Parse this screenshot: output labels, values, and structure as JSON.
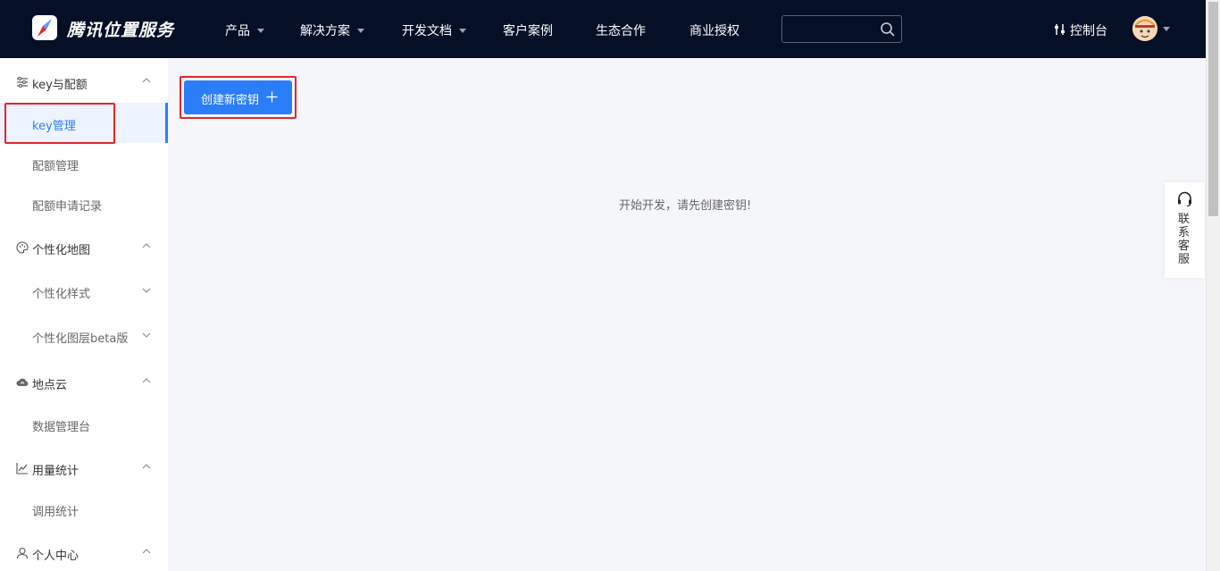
{
  "header": {
    "brand": "腾讯位置服务",
    "nav": [
      {
        "label": "产品",
        "has_dropdown": true
      },
      {
        "label": "解决方案",
        "has_dropdown": true
      },
      {
        "label": "开发文档",
        "has_dropdown": true
      },
      {
        "label": "客户案例",
        "has_dropdown": false
      },
      {
        "label": "生态合作",
        "has_dropdown": false
      },
      {
        "label": "商业授权",
        "has_dropdown": false
      }
    ],
    "search": {
      "value": "",
      "placeholder": ""
    },
    "console_label": "控制台"
  },
  "sidebar": {
    "groups": [
      {
        "label": "key与配额",
        "icon": "list-settings-icon",
        "expanded": true,
        "items": [
          {
            "label": "key管理",
            "active": true
          },
          {
            "label": "配额管理"
          },
          {
            "label": "配额申请记录"
          }
        ]
      },
      {
        "label": "个性化地图",
        "icon": "palette-icon",
        "expanded": true,
        "items": [
          {
            "label": "个性化样式",
            "expandable": true
          },
          {
            "label": "个性化图层beta版",
            "expandable": true
          }
        ]
      },
      {
        "label": "地点云",
        "icon": "cloud-icon",
        "expanded": true,
        "items": [
          {
            "label": "数据管理台"
          }
        ]
      },
      {
        "label": "用量统计",
        "icon": "line-chart-icon",
        "expanded": true,
        "items": [
          {
            "label": "调用统计"
          }
        ]
      },
      {
        "label": "个人中心",
        "icon": "user-icon",
        "expanded": true,
        "items": []
      }
    ]
  },
  "main": {
    "create_button_label": "创建新密钥",
    "empty_message": "开始开发，请先创建密钥!"
  },
  "floating": {
    "customer_service_label": "联系客服"
  },
  "colors": {
    "topbar": "#050f26",
    "accent": "#2c7ef8",
    "highlight_box": "#e5252a",
    "page_bg": "#f5f6f9"
  }
}
